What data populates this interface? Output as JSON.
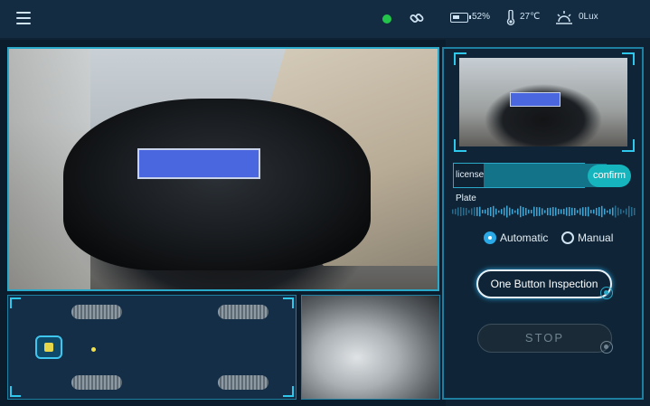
{
  "topbar": {
    "battery": "52%",
    "battery_level": 0.52,
    "temperature": "27℃",
    "light": "0Lux"
  },
  "icons": {
    "menu": "menu-icon",
    "connection_status": "status-dot",
    "link": "link-icon",
    "battery": "battery-icon",
    "temperature": "thermometer-icon",
    "light": "sun-icon"
  },
  "plate": {
    "label": "license Plate",
    "value": "",
    "confirm_label": "confirm"
  },
  "mode": {
    "automatic_label": "Automatic",
    "manual_label": "Manual",
    "selected": "Automatic"
  },
  "actions": {
    "inspect_label": "One Button Inspection",
    "stop_label": "STOP"
  },
  "colors": {
    "accent": "#2aa9c9",
    "confirm": "#16b5bd",
    "status_ok": "#22c44a",
    "plate": "#4a67e0"
  }
}
